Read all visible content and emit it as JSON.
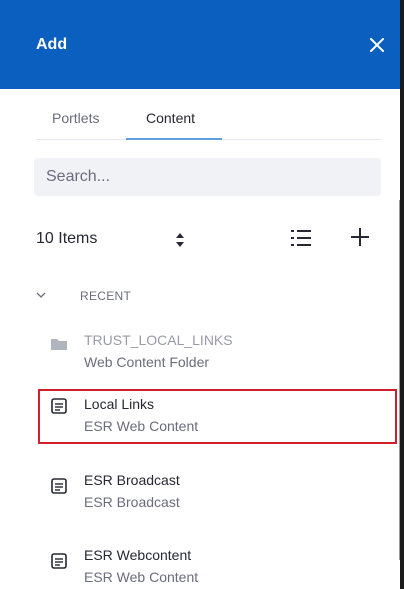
{
  "header": {
    "title": "Add",
    "close_icon": "close-icon",
    "background_color": "#0b5fbf"
  },
  "tabs": [
    {
      "label": "Portlets",
      "active": false
    },
    {
      "label": "Content",
      "active": true
    }
  ],
  "search": {
    "placeholder": "Search...",
    "value": ""
  },
  "toolbar": {
    "items_count": "10 Items",
    "sort_icon": "sort-icon",
    "list_view_icon": "list-view-icon",
    "add_icon": "plus-icon"
  },
  "section": {
    "label": "RECENT",
    "expanded": true,
    "chevron_icon": "chevron-down-icon"
  },
  "items": [
    {
      "title": "TRUST_LOCAL_LINKS",
      "subtitle": "Web Content Folder",
      "icon": "folder-icon"
    },
    {
      "title": "Local Links",
      "subtitle": "ESR Web Content",
      "icon": "web-content-icon",
      "highlighted": true
    },
    {
      "title": "ESR Broadcast",
      "subtitle": "ESR Broadcast",
      "icon": "web-content-icon"
    },
    {
      "title": "ESR Webcontent",
      "subtitle": "ESR Web Content",
      "icon": "web-content-icon"
    }
  ],
  "colors": {
    "accent": "#0b5fbf",
    "highlight": "#d0202d",
    "tab_underline": "#5e9fe0"
  }
}
